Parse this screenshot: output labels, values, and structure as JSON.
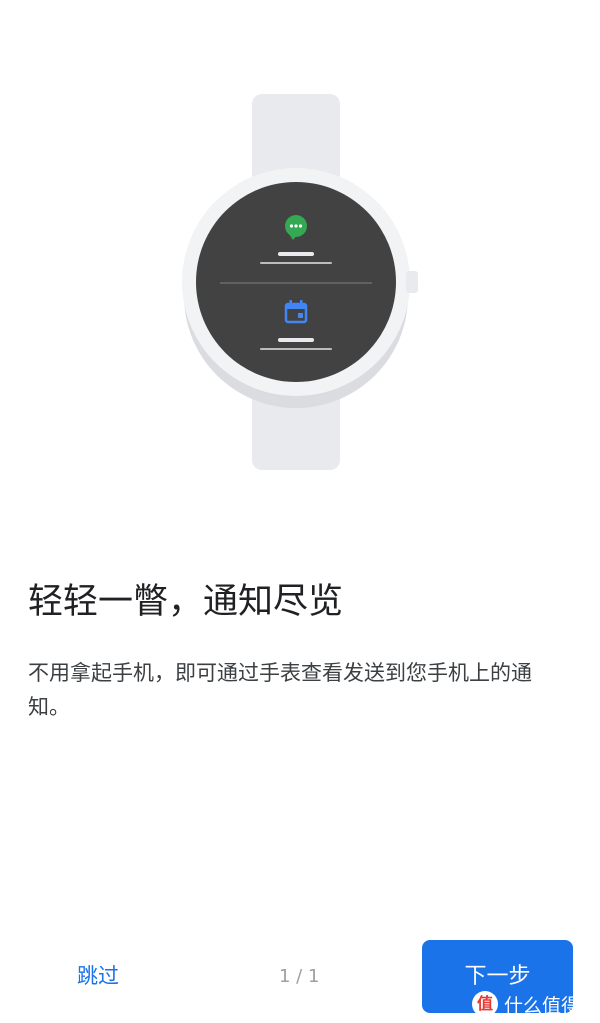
{
  "onboarding": {
    "headline": "轻轻一瞥，通知尽览",
    "description": "不用拿起手机，即可通过手表查看发送到您手机上的通知。"
  },
  "footer": {
    "skip_label": "跳过",
    "page_indicator": "1 / 1",
    "next_label": "下一步"
  },
  "watermark": {
    "logo_char": "值",
    "text": "什么值得买"
  },
  "colors": {
    "accent": "#1a73e8",
    "message_icon": "#34a853",
    "calendar_icon": "#4285f4",
    "watch_face": "#424242",
    "watch_body": "#e8eaed"
  },
  "icons": [
    "message-icon",
    "calendar-icon"
  ]
}
